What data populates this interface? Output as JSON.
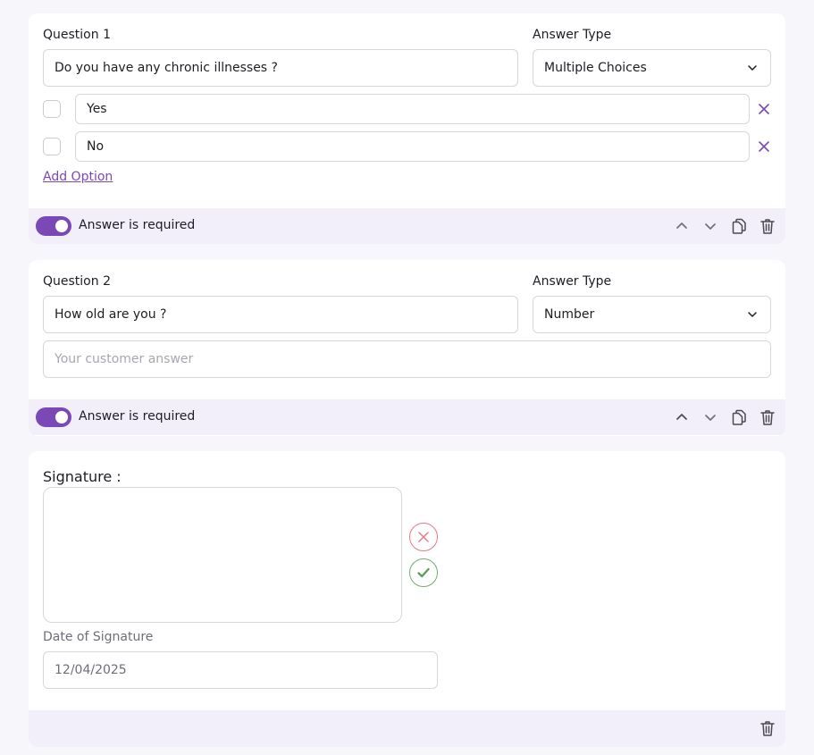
{
  "colors": {
    "accent": "#7b49b5",
    "footer_bg": "#f2effb",
    "page_bg": "#f6f6fb",
    "reject": "#e47b8a",
    "accept": "#6fae75"
  },
  "question1": {
    "label": "Question 1",
    "answer_type_label": "Answer Type",
    "question_text": "Do you have any chronic illnesses ?",
    "answer_type": "Multiple Choices",
    "options": [
      {
        "label": "Yes",
        "checked": false
      },
      {
        "label": "No",
        "checked": false
      }
    ],
    "add_option": "Add Option",
    "required_label": "Answer is required",
    "required": true
  },
  "question2": {
    "label": "Question 2",
    "answer_type_label": "Answer Type",
    "question_text": "How old are you ?",
    "answer_type": "Number",
    "answer_placeholder": "Your customer answer",
    "required_label": "Answer is required",
    "required": true
  },
  "signature": {
    "title": "Signature :",
    "date_label": "Date of Signature",
    "date_value": "12/04/2025"
  },
  "icons": {
    "chevron": "chevron-down-icon",
    "remove": "close-icon",
    "move_up": "chevron-up-icon",
    "move_down": "chevron-down-icon",
    "duplicate": "copy-icon",
    "delete": "trash-icon",
    "clear_signature": "close-icon",
    "confirm_signature": "check-icon"
  }
}
